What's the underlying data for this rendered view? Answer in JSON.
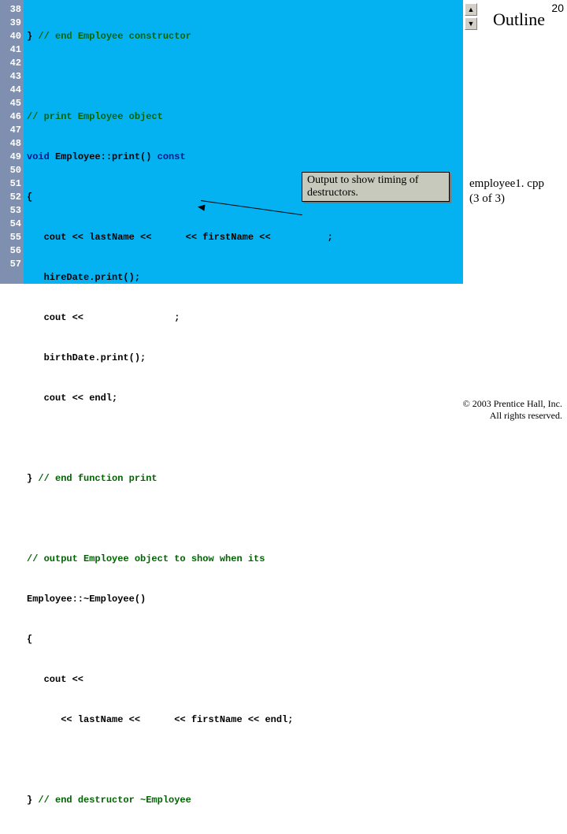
{
  "slide_number": "20",
  "outline": {
    "title": "Outline"
  },
  "file_info": {
    "name": "employee1. cpp",
    "part": "(3 of 3)"
  },
  "copyright": {
    "line1": "© 2003 Prentice Hall, Inc.",
    "line2": "All rights reserved."
  },
  "callout": {
    "text": "Output to show timing of destructors."
  },
  "scroll": {
    "up": "▲",
    "down": "▼"
  },
  "gutter": [
    "38",
    "39",
    "40",
    "41",
    "42",
    "43",
    "44",
    "45",
    "46",
    "47",
    "48",
    "49",
    "50",
    "51",
    "52",
    "53",
    "54",
    "55",
    "56",
    "57"
  ],
  "code": {
    "l38_a": "} ",
    "l38_b": "// end Employee constructor",
    "l40_a": "// print Employee object",
    "l41_a": "void",
    "l41_b": " Employee::print() ",
    "l41_c": "const",
    "l42_a": "{",
    "l43_a": "   cout << lastName << ",
    "l43_b": "     << firstName << ",
    "l43_c": "         ;",
    "l44_a": "   hireDate.print();",
    "l45_a": "   cout << ",
    "l45_b": "               ;",
    "l46_a": "   birthDate.print();",
    "l47_a": "   cout << endl;",
    "l49_a": "} ",
    "l49_b": "// end function print",
    "l51_a": "// output Employee object to show when its",
    "l52_a": "Employee::~Employee()",
    "l53_a": "{",
    "l54_a": "   cout << ",
    "l55_a": "      << lastName << ",
    "l55_b": "     << firstName << endl;",
    "l57_a": "} ",
    "l57_b": "// end destructor ~Employee"
  }
}
